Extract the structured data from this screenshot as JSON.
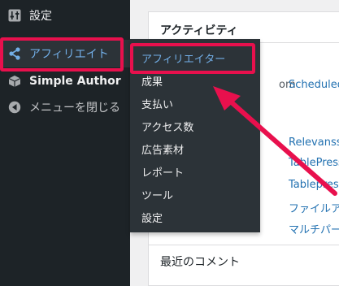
{
  "sidebar": {
    "items": [
      {
        "label": "設定",
        "icon": "settings-sliders-icon"
      },
      {
        "label": "アフィリエイト",
        "icon": "share-icon"
      },
      {
        "label": "Simple Author",
        "icon": "cube-icon"
      },
      {
        "label": "メニューを閉じる",
        "icon": "collapse-icon"
      }
    ]
  },
  "submenu": {
    "items": [
      "アフィリエイター",
      "成果",
      "支払い",
      "アクセス数",
      "広告素材",
      "レポート",
      "ツール",
      "設定"
    ]
  },
  "main": {
    "activity_title": "アクティビティ",
    "partial_text": "om",
    "scheduled": "Scheduled",
    "list_items": [
      "Relevanssi",
      "TablePress",
      "Tablepress",
      "ファイルア",
      "マルチパー"
    ],
    "recent_comments": "最近のコメント"
  },
  "colors": {
    "sidebar_bg": "#1d2327",
    "submenu_bg": "#2c3338",
    "accent": "#72aee6",
    "link": "#2271b1",
    "highlight": "#e8104d"
  }
}
